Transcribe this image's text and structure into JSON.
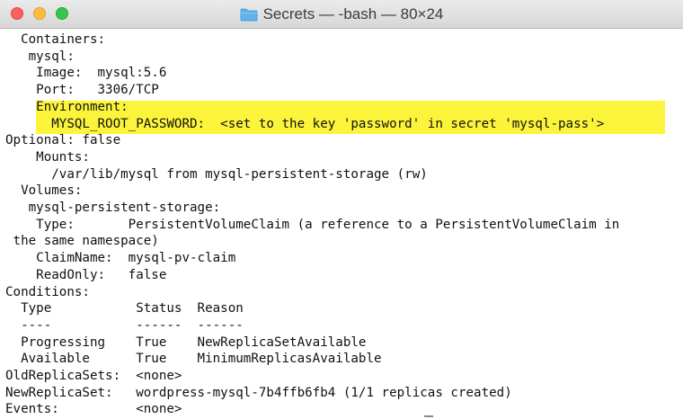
{
  "window": {
    "title": "Secrets — -bash — 80×24",
    "folder_icon": "folder-icon",
    "highlight_color": "#fbf43a"
  },
  "terminal": {
    "lines": [
      "  Containers:",
      "   mysql:",
      "    Image:  mysql:5.6",
      "    Port:   3306/TCP",
      "    Environment:",
      "      MYSQL_ROOT_PASSWORD:  <set to the key 'password' in secret 'mysql-pass'>",
      "Optional: false",
      "    Mounts:",
      "      /var/lib/mysql from mysql-persistent-storage (rw)",
      "  Volumes:",
      "   mysql-persistent-storage:",
      "    Type:       PersistentVolumeClaim (a reference to a PersistentVolumeClaim in",
      " the same namespace)",
      "    ClaimName:  mysql-pv-claim",
      "    ReadOnly:   false",
      "Conditions:",
      "  Type           Status  Reason",
      "  ----           ------  ------",
      "  Progressing    True    NewReplicaSetAvailable",
      "  Available      True    MinimumReplicasAvailable",
      "OldReplicaSets:  <none>",
      "NewReplicaSet:   wordpress-mysql-7b4ffb6fb4 (1/1 replicas created)",
      "Events:          <none>"
    ]
  }
}
